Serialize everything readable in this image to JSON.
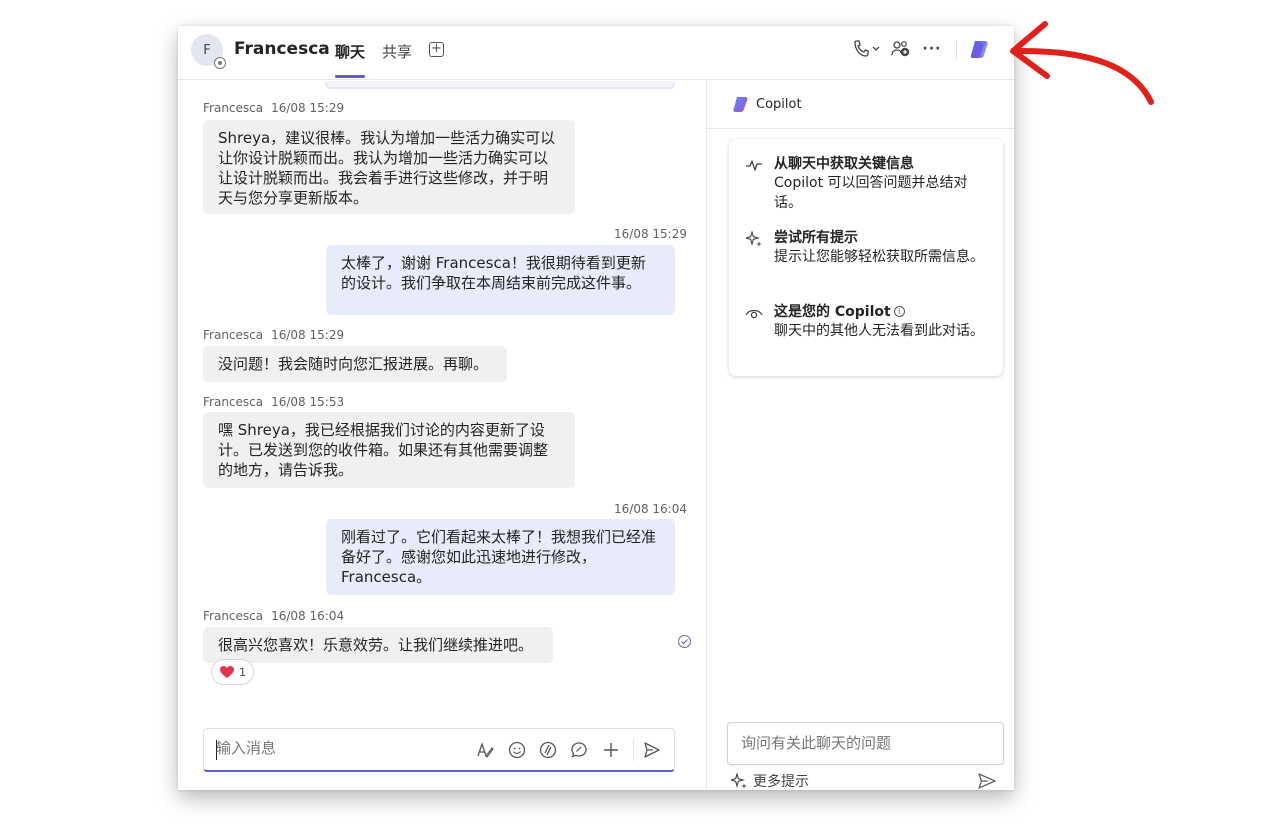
{
  "header": {
    "avatar_initial": "F",
    "contact_name": "Francesca",
    "tabs": [
      "聊天",
      "共享"
    ],
    "add_tab_label": "+",
    "more_label": "···"
  },
  "messages": [
    {
      "direction": "in",
      "sender": "Francesca",
      "time": "16/08 15:29",
      "text": "Shreya，建议很棒。我认为增加一些活力确实可以让你设计脱颖而出。我认为增加一些活力确实可以让设计脱颖而出。我会着手进行这些修改，并于明天与您分享更新版本。"
    },
    {
      "direction": "out",
      "time": "16/08 15:29",
      "text": "太棒了，谢谢 Francesca！我很期待看到更新的设计。我们争取在本周结束前完成这件事。"
    },
    {
      "direction": "in",
      "sender": "Francesca",
      "time": "16/08 15:29",
      "text": "没问题！我会随时向您汇报进展。再聊。"
    },
    {
      "direction": "in",
      "sender": "Francesca",
      "time": "16/08 15:53",
      "text": "嘿 Shreya，我已经根据我们讨论的内容更新了设计。已发送到您的收件箱。如果还有其他需要调整的地方，请告诉我。"
    },
    {
      "direction": "out",
      "time": "16/08 16:04",
      "text": "刚看过了。它们看起来太棒了！我想我们已经准备好了。感谢您如此迅速地进行修改，Francesca。"
    },
    {
      "direction": "in",
      "sender": "Francesca",
      "time": "16/08 16:04",
      "text": "很高兴您喜欢！乐意效劳。让我们继续推进吧。"
    }
  ],
  "reaction": {
    "emoji": "❤️",
    "count": "1"
  },
  "composer": {
    "placeholder": "输入消息"
  },
  "copilot": {
    "title": "Copilot",
    "items": [
      {
        "icon": "pulse-icon",
        "title": "从聊天中获取关键信息",
        "desc": "Copilot 可以回答问题并总结对话。"
      },
      {
        "icon": "sparkle-icon",
        "title": "尝试所有提示",
        "desc": "提示让您能够轻松获取所需信息。"
      },
      {
        "icon": "eye-icon",
        "title": "这是您的 Copilot",
        "desc": "聊天中的其他人无法看到此对话。"
      }
    ],
    "input_placeholder": "询问有关此聊天的问题",
    "more_prompts": "更多提示"
  },
  "colors": {
    "accent": "#5b5fc7",
    "outgoing_bubble": "#e8ebfa",
    "incoming_bubble": "#f0f0f0",
    "annotation_arrow": "#e0201b"
  }
}
